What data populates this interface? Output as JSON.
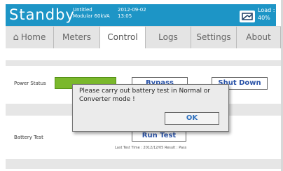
{
  "header": {
    "title": "Standby",
    "model_line1": "Untitled",
    "model_line2": "Modular 60kVA",
    "date": "2012-09-02",
    "time": "13:05",
    "load_label": "Load :",
    "load_value": "40%",
    "background_color": "#1d95c6",
    "icon": "ups-status-icon"
  },
  "tabs": [
    {
      "label": "Home",
      "icon": "home-icon",
      "active": false
    },
    {
      "label": "Meters",
      "active": false
    },
    {
      "label": "Control",
      "active": true
    },
    {
      "label": "Logs",
      "active": false
    },
    {
      "label": "Settings",
      "active": false
    },
    {
      "label": "About",
      "active": false
    }
  ],
  "power_status": {
    "label": "Power Status",
    "bypass_label": "Bypass",
    "shutdown_label": "Shut Down",
    "active_button_color": "#7ab82c"
  },
  "battery_test": {
    "label": "Battery Test",
    "button_label": "Run Test",
    "last_test": "Last Test Time : 2012/12/05  Result : Pass"
  },
  "dialog": {
    "message": "Please carry out battery test in Normal or Converter mode !",
    "ok_label": "OK"
  }
}
